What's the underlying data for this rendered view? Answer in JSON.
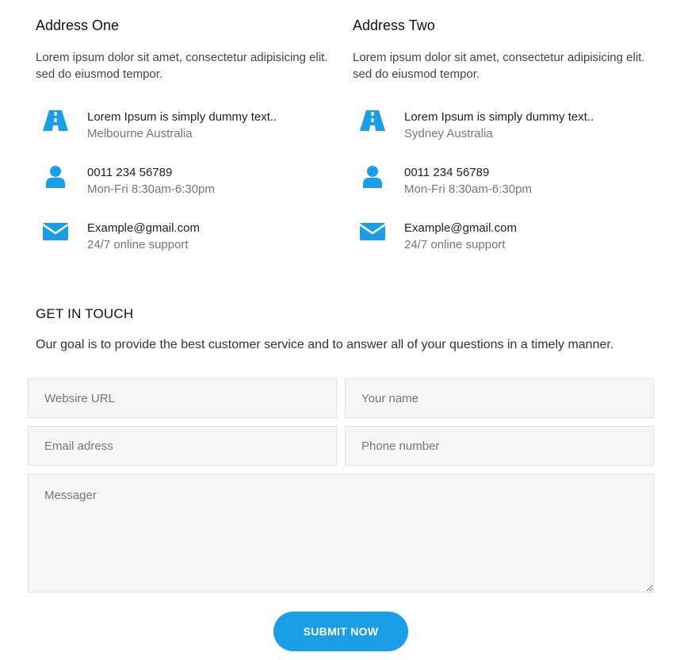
{
  "address_one": {
    "title": "Address One",
    "description": "Lorem ipsum dolor sit amet, consectetur adipisicing elit. sed do eiusmod tempor.",
    "items": [
      {
        "icon": "road-icon",
        "main": "Lorem Ipsum is simply dummy text..",
        "sub": "Melbourne Australia"
      },
      {
        "icon": "user-icon",
        "main": "0011 234 56789",
        "sub": "Mon-Fri 8:30am-6:30pm"
      },
      {
        "icon": "envelope-icon",
        "main": "Example@gmail.com",
        "sub": "24/7 online support"
      }
    ]
  },
  "address_two": {
    "title": "Address Two",
    "description": "Lorem ipsum dolor sit amet, consectetur adipisicing elit. sed do eiusmod tempor.",
    "items": [
      {
        "icon": "road-icon",
        "main": "Lorem Ipsum is simply dummy text..",
        "sub": "Sydney Australia"
      },
      {
        "icon": "user-icon",
        "main": "0011 234 56789",
        "sub": "Mon-Fri 8:30am-6:30pm"
      },
      {
        "icon": "envelope-icon",
        "main": "Example@gmail.com",
        "sub": "24/7 online support"
      }
    ]
  },
  "contact": {
    "title": "GET IN TOUCH",
    "description": "Our goal is to provide the best customer service and to answer all of your questions in a timely manner.",
    "fields": {
      "website_placeholder": "Websire URL",
      "name_placeholder": "Your name",
      "email_placeholder": "Email adress",
      "phone_placeholder": "Phone number",
      "message_placeholder": "Messager"
    },
    "submit_label": "SUBMIT NOW"
  },
  "colors": {
    "accent": "#1a9ee6",
    "field_bg": "#f6f6f6"
  }
}
